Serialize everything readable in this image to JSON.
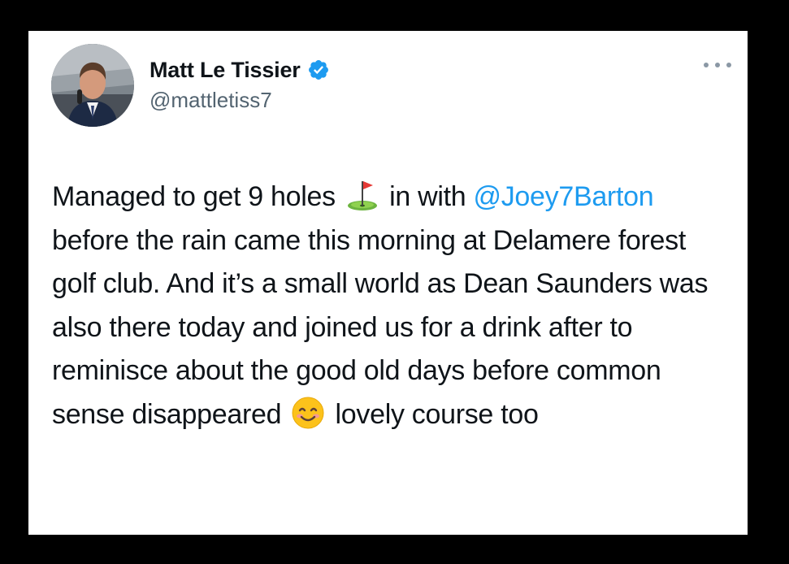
{
  "tweet": {
    "display_name": "Matt Le Tissier",
    "handle": "@mattletiss7",
    "verified": true,
    "avatar_icon": "profile-photo-avatar",
    "more_icon": "more-options-icon",
    "text": {
      "part1": "Managed to get 9 holes ",
      "emoji1": "golf-flag-emoji",
      "part2": " in with ",
      "mention": "@Joey7Barton",
      "part3": " before the rain came this morning at Delamere forest golf club. And it’s a small world as Dean Saunders was also there today and joined us for a drink after to reminisce about the good old days before common sense disappeared ",
      "emoji2": "smiling-face-emoji",
      "part4": " lovely course too"
    }
  },
  "colors": {
    "background": "#000000",
    "card": "#ffffff",
    "text": "#0f1419",
    "secondary": "#536471",
    "accent": "#1d9bf0"
  }
}
